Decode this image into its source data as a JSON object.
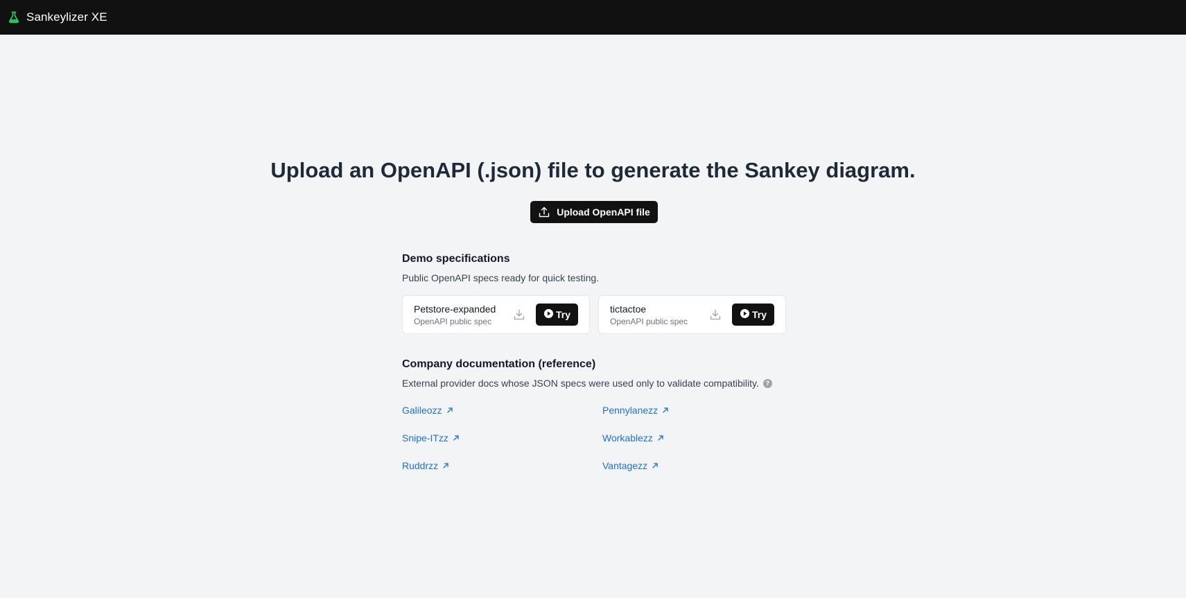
{
  "header": {
    "app_title": "Sankeylizer XE",
    "logo_icon": "flask-icon",
    "logo_color": "#22c55e"
  },
  "main": {
    "headline": "Upload an OpenAPI (.json) file to generate the Sankey diagram.",
    "upload_button": {
      "label": "Upload OpenAPI file",
      "icon": "upload-icon"
    }
  },
  "demo": {
    "title": "Demo specifications",
    "description": "Public OpenAPI specs ready for quick testing.",
    "cards": [
      {
        "name": "Petstore-expanded",
        "subtitle": "OpenAPI public spec",
        "try_label": "Try"
      },
      {
        "name": "tictactoe",
        "subtitle": "OpenAPI public spec",
        "try_label": "Try"
      }
    ]
  },
  "company": {
    "title": "Company documentation (reference)",
    "description": "External provider docs whose JSON specs were used only to validate compatibility.",
    "help_glyph": "?",
    "links": [
      "Galileozz",
      "Pennylanezz",
      "Snipe-ITzz",
      "Workablezz",
      "Ruddrzz",
      "Vantagezz"
    ],
    "link_color": "#1d6fe0"
  }
}
